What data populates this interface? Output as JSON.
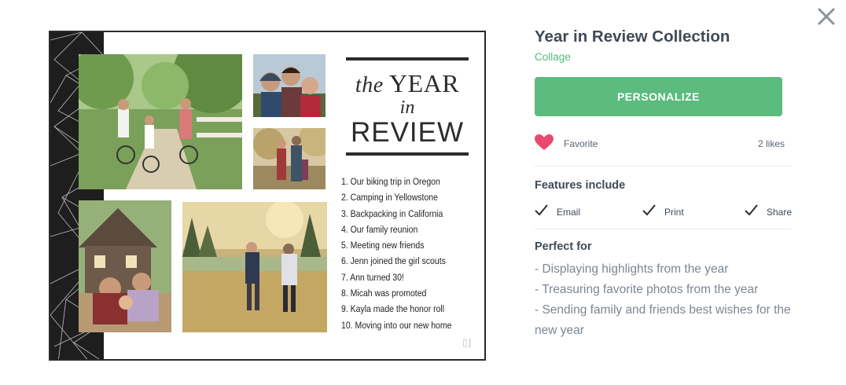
{
  "product": {
    "title": "Year in Review Collection",
    "category": "Collage",
    "personalize_label": "PERSONALIZE"
  },
  "favorite": {
    "label": "Favorite",
    "likes": "2 likes",
    "heart_color": "#e84a6f"
  },
  "features": {
    "heading": "Features include",
    "items": [
      "Email",
      "Print",
      "Share"
    ]
  },
  "perfect_for": {
    "heading": "Perfect for",
    "items": [
      "- Displaying highlights from the year",
      "- Treasuring favorite photos from the year",
      "- Sending family and friends best wishes for the new year"
    ]
  },
  "card": {
    "title_the": "the",
    "title_year": "YEAR",
    "title_in": "in",
    "title_review": "REVIEW",
    "list": [
      "1. Our biking trip in Oregon",
      "2. Camping in Yellowstone",
      "3. Backpacking in California",
      "4. Our family reunion",
      "5. Meeting new friends",
      "6. Jenn joined the girl scouts",
      "7. Ann turned 30!",
      "8. Micah was promoted",
      "9. Kayla made the honor roll",
      "10. Moving into our new home"
    ]
  },
  "colors": {
    "accent_green": "#5cbb7e",
    "category_green": "#56b97b",
    "text_dark": "#3f4a57",
    "text_muted": "#7c8691"
  },
  "icons": {
    "close": "close-icon",
    "heart": "heart-icon",
    "check": "check-icon"
  }
}
